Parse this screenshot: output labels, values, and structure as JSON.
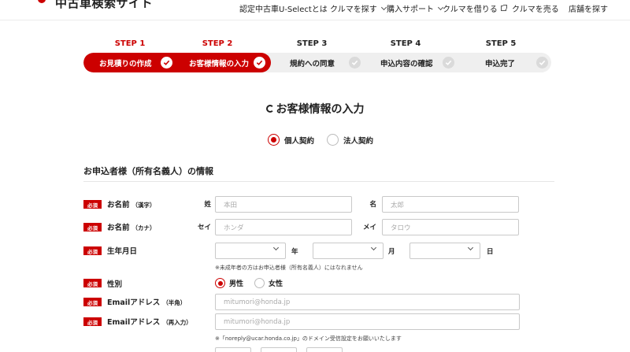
{
  "header": {
    "site_title": "中古車検索サイト",
    "nav": [
      {
        "label": "認定中古車U-Selectとは",
        "icon": ""
      },
      {
        "label": "クルマを探す",
        "icon": "chevron-down-icon"
      },
      {
        "label": "購入サポート",
        "icon": "chevron-down-icon"
      },
      {
        "label": "クルマを借りる",
        "icon": "external-link-icon"
      },
      {
        "label": "クルマを売る",
        "icon": ""
      },
      {
        "label": "店舗を探す",
        "icon": ""
      }
    ]
  },
  "steps": [
    {
      "number": "STEP 1",
      "name": "お見積りの作成",
      "state": "done"
    },
    {
      "number": "STEP 2",
      "name": "お客様情報の入力",
      "state": "current"
    },
    {
      "number": "STEP 3",
      "name": "規約への同意",
      "state": "todo"
    },
    {
      "number": "STEP 4",
      "name": "申込内容の確認",
      "state": "todo"
    },
    {
      "number": "STEP 5",
      "name": "申込完了",
      "state": "todo"
    }
  ],
  "page_title": "お客様情報の入力",
  "contract_type": {
    "options": [
      {
        "label": "個人契約",
        "checked": true
      },
      {
        "label": "法人契約",
        "checked": false
      }
    ]
  },
  "section_title": "お申込者様（所有名義人）の情報",
  "required_badge": "必須",
  "form": {
    "name_kanji": {
      "label": "お名前",
      "sub": "（漢字）",
      "sei_label": "姓",
      "sei_placeholder": "本田",
      "mei_label": "名",
      "mei_placeholder": "太郎"
    },
    "name_kana": {
      "label": "お名前",
      "sub": "（カナ）",
      "sei_label": "セイ",
      "sei_placeholder": "ホンダ",
      "mei_label": "メイ",
      "mei_placeholder": "タロウ"
    },
    "birthdate": {
      "label": "生年月日",
      "year_label": "年",
      "month_label": "月",
      "day_label": "日",
      "year_value": "",
      "month_value": "",
      "day_value": "",
      "note": "※未成年者の方はお申込者様（所有名義人）にはなれません"
    },
    "gender": {
      "label": "性別",
      "options": [
        {
          "label": "男性",
          "checked": true
        },
        {
          "label": "女性",
          "checked": false
        }
      ]
    },
    "email": {
      "label": "Emailアドレス",
      "sub": "（半角）",
      "placeholder": "mitumori@honda.jp"
    },
    "email_confirm": {
      "label": "Emailアドレス",
      "sub": "（再入力）",
      "placeholder": "mitumori@honda.jp",
      "note": "※「noreply@ucar.honda.co.jp」のドメイン受信設定をお願いいたします"
    }
  },
  "colors": {
    "accent": "#cc0000",
    "inactive_step": "#efefef",
    "border": "#c9c9c9"
  }
}
